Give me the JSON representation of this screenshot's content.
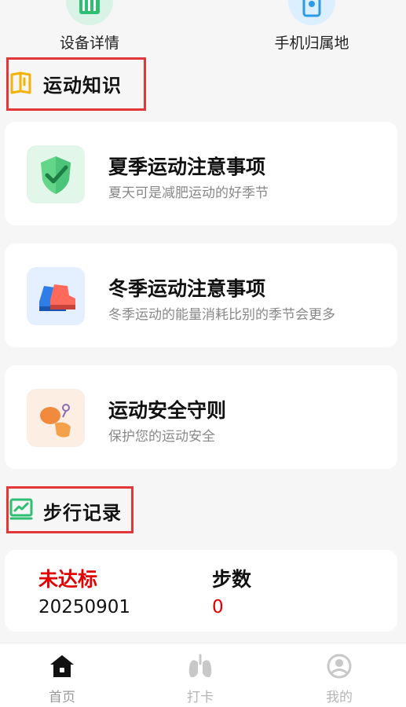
{
  "top_tools": [
    {
      "label": "设备详情",
      "icon": "device-icon"
    },
    {
      "label": "手机归属地",
      "icon": "location-phone-icon"
    }
  ],
  "knowledge": {
    "title": "运动知识",
    "icon": "book-icon",
    "items": [
      {
        "title": "夏季运动注意事项",
        "subtitle": "夏天可是减肥运动的好季节",
        "icon": "shield-check-icon"
      },
      {
        "title": "冬季运动注意事项",
        "subtitle": "冬季运动的能量消耗比别的季节会更多",
        "icon": "sneakers-icon"
      },
      {
        "title": "运动安全守则",
        "subtitle": "保护您的运动安全",
        "icon": "gloves-icon"
      }
    ]
  },
  "walk_record": {
    "title": "步行记录",
    "icon": "chart-icon",
    "status_label": "未达标",
    "date": "20250901",
    "steps_label": "步数",
    "steps_value": "0"
  },
  "bottom_nav": [
    {
      "label": "首页",
      "icon": "home-icon",
      "active": true
    },
    {
      "label": "打卡",
      "icon": "lungs-icon",
      "active": false
    },
    {
      "label": "我的",
      "icon": "user-icon",
      "active": false
    }
  ],
  "colors": {
    "accent_red": "#e00000",
    "highlight_border": "#e0383a",
    "inactive": "#c8c8c8"
  }
}
